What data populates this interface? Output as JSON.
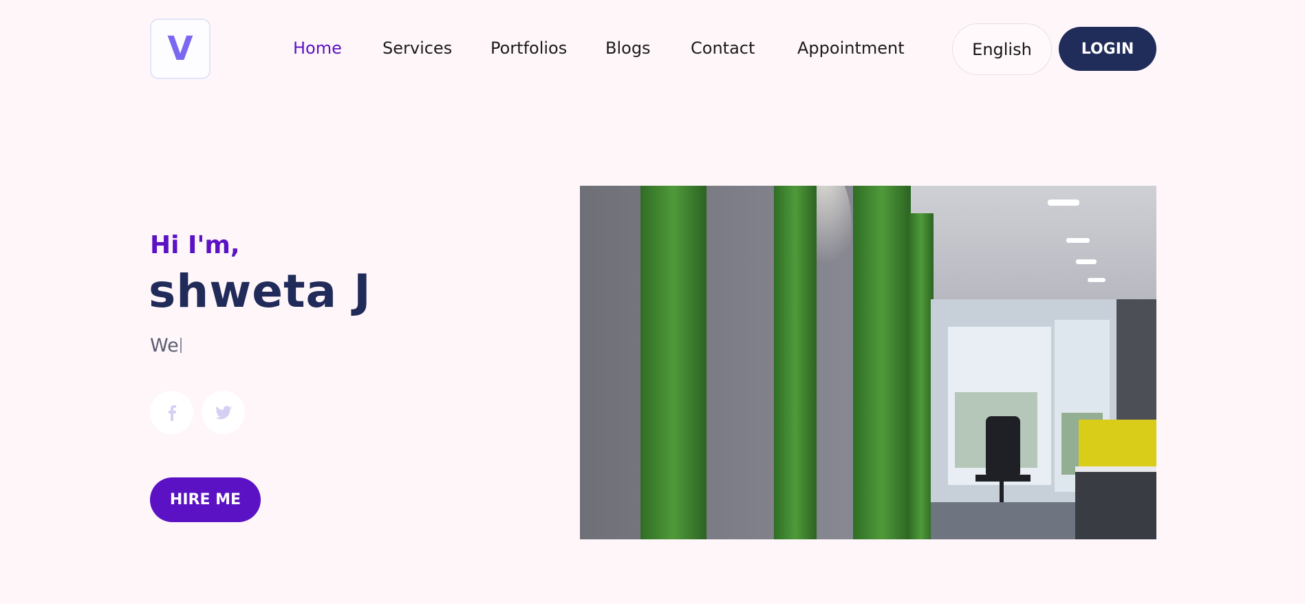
{
  "brand": {
    "logo_letter": "V",
    "accent_color": "#5a12c4",
    "navy_color": "#202c5a",
    "background_color": "#fff6fa"
  },
  "nav": {
    "items": [
      {
        "label": "Home",
        "active": true
      },
      {
        "label": "Services",
        "active": false
      },
      {
        "label": "Portfolios",
        "active": false
      },
      {
        "label": "Blogs",
        "active": false
      },
      {
        "label": "Contact",
        "active": false
      },
      {
        "label": "Appointment",
        "active": false
      }
    ],
    "language_label": "English",
    "login_label": "LOGIN"
  },
  "hero": {
    "greeting": "Hi I'm,",
    "name": "shweta J",
    "typed_text": "We",
    "social": [
      {
        "icon": "facebook-icon"
      },
      {
        "icon": "twitter-icon"
      }
    ],
    "cta_label": "HIRE ME",
    "image_alt": "office interior with green wall panels"
  }
}
